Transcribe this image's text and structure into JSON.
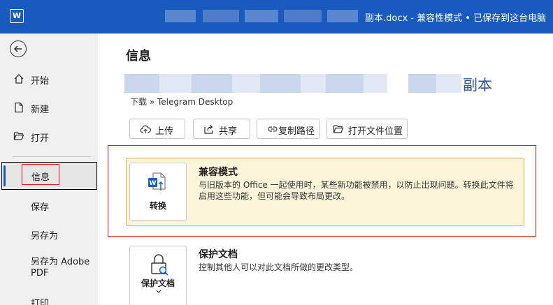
{
  "titlebar": {
    "app_icon": "word-logo-icon",
    "app_letter": "W",
    "document_title": "副本.docx  -  兼容性模式 • 已保存到这台电脑",
    "accent_color": "#185abd"
  },
  "sidebar": {
    "back_icon": "back-arrow-icon",
    "items": [
      {
        "label": "开始",
        "icon": "home-icon"
      },
      {
        "label": "新建",
        "icon": "new-document-icon"
      },
      {
        "label": "打开",
        "icon": "open-folder-icon"
      },
      {
        "label": "信息",
        "active": true
      },
      {
        "label": "保存"
      },
      {
        "label": "另存为"
      },
      {
        "label": "另存为 Adobe PDF"
      },
      {
        "label": "打印"
      }
    ]
  },
  "main": {
    "page_title": "信息",
    "doc_name_suffix": "副本",
    "path": "下载 » Telegram Desktop",
    "actions": [
      {
        "label": "上传",
        "icon": "upload-cloud-icon"
      },
      {
        "label": "共享",
        "icon": "share-icon"
      },
      {
        "label": "复制路径",
        "icon": "link-icon"
      },
      {
        "label": "打开文件位置",
        "icon": "folder-icon"
      }
    ],
    "compat": {
      "tile_label": "转换",
      "title": "兼容模式",
      "description": "与旧版本的 Office 一起使用时，某些新功能被禁用，以防止出现问题。转换此文件将启用这些功能，但可能会导致布局更改。",
      "highlight_color": "#fdf5d9"
    },
    "protect": {
      "tile_label": "保护文档",
      "title": "保护文档",
      "description": "控制其他人可以对此文档所做的更改类型。"
    }
  }
}
